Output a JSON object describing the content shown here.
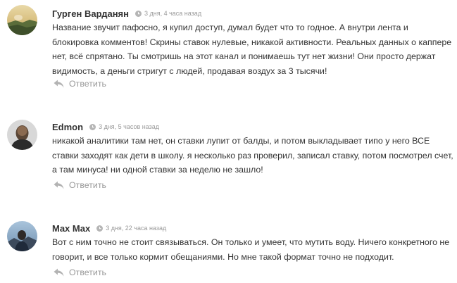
{
  "comments": [
    {
      "author": "Гурген Варданян",
      "time": "3 дня, 4 часа назад",
      "text": "Название звучит пафосно, я купил доступ, думал будет что то годное. А внутри лента и блокировка комментов! Скрины ставок нулевые, никакой активности. Реальных данных о каппере нет, всё спрятано. Ты смотришь на этот канал и понимаешь тут нет жизни! Они просто держат видимость, а деньги стригут с людей, продавая воздух за 3 тысячи!",
      "reply_label": "Ответить",
      "avatar_icon": "user-avatar-photo"
    },
    {
      "author": "Edmon",
      "time": "3 дня, 5 часов назад",
      "text": "никакой аналитики там нет, он ставки лупит от балды, и потом выкладывает типо у него ВСЕ ставки заходят как дети в школу. я несколько раз проверил, записал ставку, потом посмотрел счет, а там минуса! ни одной ставки за неделю не зашло!",
      "reply_label": "Ответить",
      "avatar_icon": "user-avatar-photo"
    },
    {
      "author": "Max Max",
      "time": "3 дня, 22 часа назад",
      "text": "Вот с ним точно не стоит связываться. Он только и умеет, что мутить воду. Ничего конкретного не говорит, и все только кормит обещаниями. Но мне такой формат точно не подходит.",
      "reply_label": "Ответить",
      "avatar_icon": "user-avatar-photo"
    }
  ],
  "colors": {
    "text": "#333333",
    "muted": "#999999",
    "background": "#ffffff"
  },
  "icons": {
    "time": "clock-icon",
    "reply": "reply-arrow-icon"
  }
}
